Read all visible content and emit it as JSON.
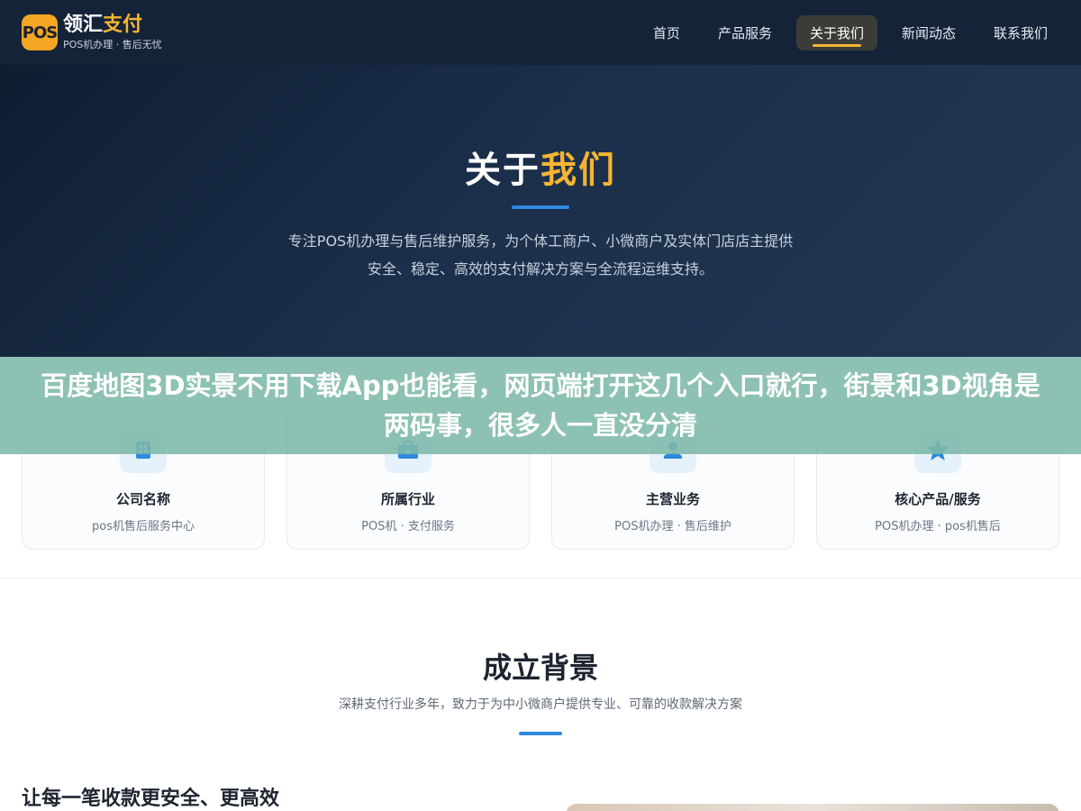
{
  "header": {
    "logo_badge": "POS",
    "brand_name_part1": "领汇",
    "brand_name_part2": "支付",
    "brand_sub": "POS机办理 · 售后无忧",
    "nav": [
      "首页",
      "产品服务",
      "关于我们",
      "新闻动态",
      "联系我们"
    ],
    "active_nav": "关于我们",
    "colors": {
      "bg": "#142338",
      "accent": "#f5b531"
    }
  },
  "hero": {
    "title_part1": "关于",
    "title_part2": "我们",
    "desc_line1": "专注POS机办理与售后维护服务，为个体工商户、小微商户及实体门店店主提供",
    "desc_line2": "安全、稳定、高效的支付解决方案与全流程运维支持。"
  },
  "banner": {
    "text": "百度地图3D实景不用下载App也能看，网页端打开这几个入口就行，街景和3D视角是两码事，很多人一直没分清"
  },
  "cards": [
    {
      "icon": "building-icon",
      "title": "公司名称",
      "sub": "pos机售后服务中心"
    },
    {
      "icon": "briefcase-icon",
      "title": "所属行业",
      "sub": "POS机 · 支付服务"
    },
    {
      "icon": "handshake-icon",
      "title": "主营业务",
      "sub": "POS机办理 · 售后维护"
    },
    {
      "icon": "star-icon",
      "title": "核心产品/服务",
      "sub": "POS机办理 · pos机售后"
    }
  ],
  "background": {
    "title": "成立背景",
    "desc": "深耕支付行业多年，致力于为中小微商户提供专业、可靠的收款解决方案",
    "heading": "让每一笔收款更安全、更高效"
  }
}
